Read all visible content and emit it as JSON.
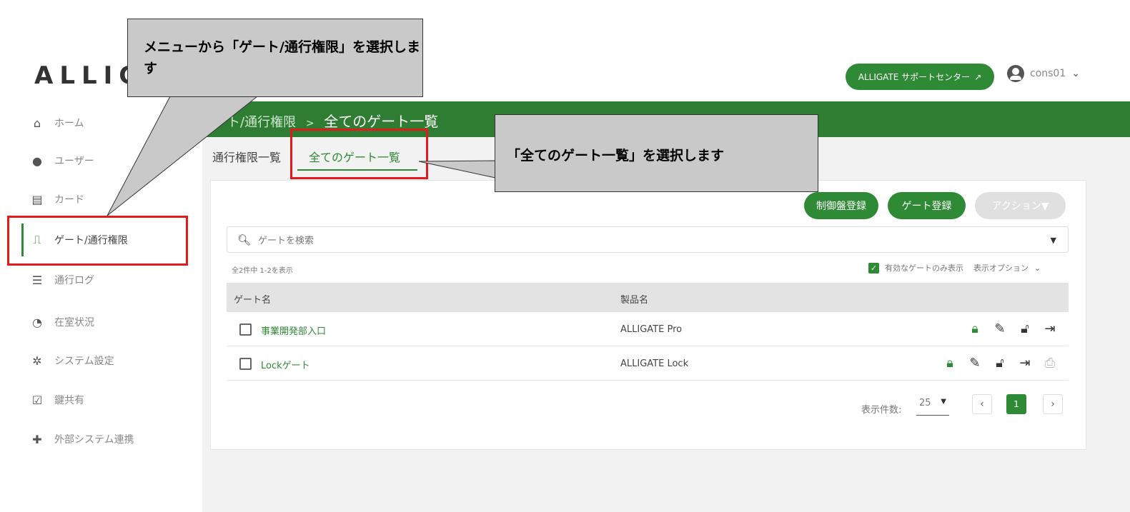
{
  "app": {
    "logo": "ALLIGATE"
  },
  "header": {
    "support_label": "ALLIGATE サポートセンター",
    "username": "cons01"
  },
  "sidebar": {
    "items": [
      {
        "label": "ホーム",
        "icon": "home-icon"
      },
      {
        "label": "ユーザー",
        "icon": "user-icon"
      },
      {
        "label": "カード",
        "icon": "card-icon"
      },
      {
        "label": "ゲート/通行権限",
        "icon": "door-icon"
      },
      {
        "label": "通行ログ",
        "icon": "list-icon"
      },
      {
        "label": "在室状況",
        "icon": "presence-icon"
      },
      {
        "label": "システム設定",
        "icon": "gear-icon"
      },
      {
        "label": "鍵共有",
        "icon": "checkbox-icon"
      },
      {
        "label": "外部システム連携",
        "icon": "puzzle-icon"
      }
    ]
  },
  "breadcrumb": {
    "parent": "ート/通行権限",
    "separator": ">",
    "current": "全てのゲート一覧"
  },
  "tabs": [
    {
      "label": "通行権限一覧"
    },
    {
      "label": "全てのゲート一覧"
    }
  ],
  "actions": {
    "register_panel": "制御盤登録",
    "register_gate": "ゲート登録",
    "action": "アクション▼"
  },
  "search": {
    "placeholder": "ゲートを検索"
  },
  "list": {
    "count_text": "全2件中 1-2を表示",
    "filter_label": "有効なゲートのみ表示",
    "display_options": "表示オプション",
    "columns": [
      "ゲート名",
      "製品名"
    ],
    "rows": [
      {
        "gate": "事業開発部入口",
        "product": "ALLIGATE Pro"
      },
      {
        "gate": "Lockゲート",
        "product": "ALLIGATE Lock"
      }
    ]
  },
  "pagination": {
    "label": "表示件数:",
    "per_page": "25",
    "current_page": "1"
  },
  "callouts": {
    "menu": "メニューから「ゲート/通行権限」を選択します",
    "tab": "「全てのゲート一覧」を選択します"
  },
  "colors": {
    "accent": "#2f8a35",
    "header_bar": "#2f7d33",
    "highlight": "#e11b1b",
    "callout": "#c9c9c9"
  }
}
